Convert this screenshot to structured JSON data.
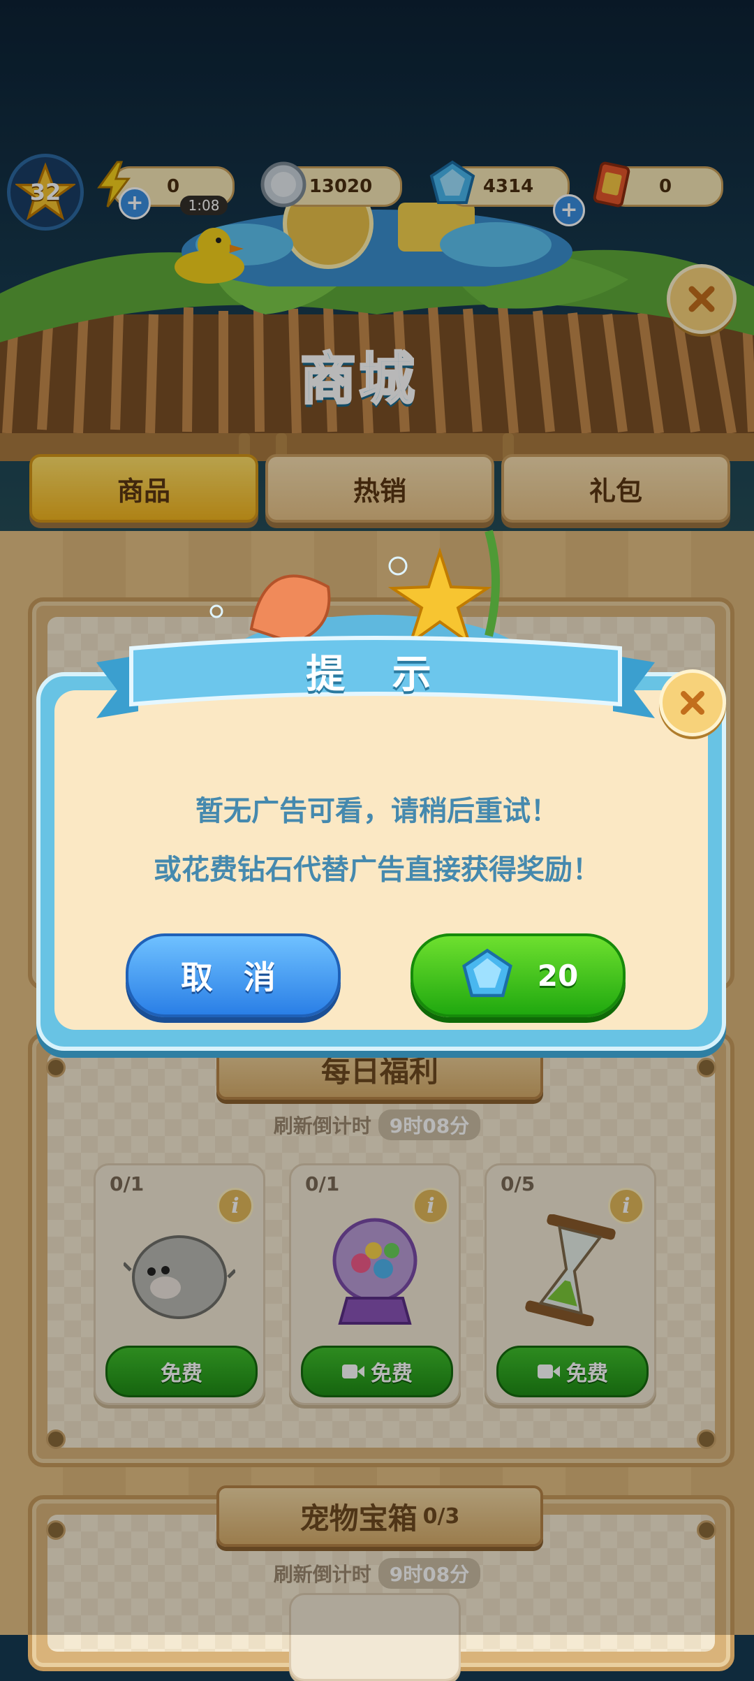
{
  "player": {
    "level": "32"
  },
  "resources": {
    "energy": {
      "value": "0",
      "timer": "1:08",
      "icon": "lightning-icon"
    },
    "coins": {
      "value": "13020",
      "icon": "coin-icon"
    },
    "diamonds": {
      "value": "4314",
      "icon": "diamond-icon"
    },
    "tickets": {
      "value": "0",
      "icon": "ticket-icon"
    }
  },
  "shop": {
    "title": "商城",
    "tabs": [
      {
        "label": "商品",
        "active": true
      },
      {
        "label": "热销",
        "active": false
      },
      {
        "label": "礼包",
        "active": false
      }
    ]
  },
  "daily": {
    "title": "每日福利",
    "refresh_label": "刷新倒计时",
    "refresh_time": "9时08分",
    "items": [
      {
        "count": "0/1",
        "button": "免费",
        "icon": "pufferfish-icon",
        "video": false
      },
      {
        "count": "0/1",
        "button": "免费",
        "icon": "gumball-machine-icon",
        "video": true
      },
      {
        "count": "0/5",
        "button": "免费",
        "icon": "hourglass-icon",
        "video": true
      }
    ]
  },
  "pet_chest": {
    "title": "宠物宝箱",
    "progress": "0/3",
    "refresh_label": "刷新倒计时",
    "refresh_time": "9时08分"
  },
  "dialog": {
    "title": "提 示",
    "line1": "暂无广告可看，请稍后重试！",
    "line2": "或花费钻石代替广告直接获得奖励！",
    "cancel_label": "取 消",
    "diamond_cost": "20"
  },
  "colors": {
    "dialog_frame": "#68c3e4",
    "dialog_body": "#fbe8c4",
    "message_text": "#4589ae",
    "cancel_button": "#2a7fe6",
    "confirm_button": "#20a80f"
  }
}
